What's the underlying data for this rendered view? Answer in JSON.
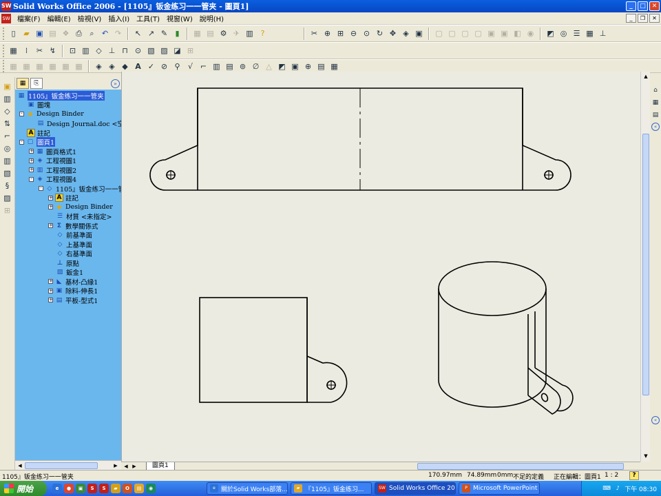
{
  "window": {
    "title": "Solid Works Office 2006 - [1105』钣金练习一一管夹 - 圖頁1]",
    "app_icon_text": "SW",
    "minimize": "_",
    "maximize": "□",
    "close": "✕"
  },
  "menu": {
    "items": [
      "檔案(F)",
      "編輯(E)",
      "檢視(V)",
      "插入(I)",
      "工具(T)",
      "視窗(W)",
      "說明(H)"
    ],
    "doc_minimize": "_",
    "doc_restore": "❐",
    "doc_close": "✕"
  },
  "feature_manager": {
    "tab1": "▦",
    "tab2": "⎘",
    "collapse": "»",
    "tree": [
      {
        "label": "1105』钣金练习一一管夹",
        "icon": "drawing-icon",
        "glyph": "▦",
        "indent": 0,
        "exp": "",
        "selected": true
      },
      {
        "label": "圖塊",
        "icon": "blocks-icon",
        "glyph": "▣",
        "indent": 1,
        "exp": ""
      },
      {
        "label": "Design Binder",
        "icon": "design-binder-icon",
        "glyph": "◆",
        "indent": 1,
        "exp": "-"
      },
      {
        "label": "Design Journal.doc <空白>",
        "icon": "document-icon",
        "glyph": "▤",
        "indent": 2,
        "exp": ""
      },
      {
        "label": "註記",
        "icon": "annotations-icon",
        "glyph": "A",
        "indent": 1,
        "exp": ""
      },
      {
        "label": "圖頁1",
        "icon": "sheet-icon",
        "glyph": "▢",
        "indent": 1,
        "exp": "-",
        "selected": true
      },
      {
        "label": "圖頁格式1",
        "icon": "sheet-format-icon",
        "glyph": "▦",
        "indent": 2,
        "exp": "+"
      },
      {
        "label": "工程視圖1",
        "icon": "drawing-view-icon",
        "glyph": "◈",
        "indent": 2,
        "exp": "+"
      },
      {
        "label": "工程視圖2",
        "icon": "drawing-view-icon",
        "glyph": "▥",
        "indent": 2,
        "exp": "+"
      },
      {
        "label": "工程視圖4",
        "icon": "drawing-view-icon",
        "glyph": "◈",
        "indent": 2,
        "exp": "-"
      },
      {
        "label": "1105』钣金练习一一管",
        "icon": "part-icon",
        "glyph": "◇",
        "indent": 3,
        "exp": "-"
      },
      {
        "label": "註記",
        "icon": "annotations-icon",
        "glyph": "A",
        "indent": 4,
        "exp": "+"
      },
      {
        "label": "Design Binder",
        "icon": "design-binder-icon",
        "glyph": "◆",
        "indent": 4,
        "exp": "+"
      },
      {
        "label": "材質 <未指定>",
        "icon": "material-icon",
        "glyph": "☰",
        "indent": 4,
        "exp": ""
      },
      {
        "label": "數學關係式",
        "icon": "equations-icon",
        "glyph": "Σ",
        "indent": 4,
        "exp": "+"
      },
      {
        "label": "前基準面",
        "icon": "plane-icon",
        "glyph": "◇",
        "indent": 4,
        "exp": ""
      },
      {
        "label": "上基準面",
        "icon": "plane-icon",
        "glyph": "◇",
        "indent": 4,
        "exp": ""
      },
      {
        "label": "右基準面",
        "icon": "plane-icon",
        "glyph": "◇",
        "indent": 4,
        "exp": ""
      },
      {
        "label": "原點",
        "icon": "origin-icon",
        "glyph": "⊥",
        "indent": 4,
        "exp": ""
      },
      {
        "label": "鈑金1",
        "icon": "sheet-metal-icon",
        "glyph": "▧",
        "indent": 4,
        "exp": ""
      },
      {
        "label": "基材-凸緣1",
        "icon": "base-flange-icon",
        "glyph": "◣",
        "indent": 4,
        "exp": "+"
      },
      {
        "label": "除料-伸長1",
        "icon": "cut-extrude-icon",
        "glyph": "▣",
        "indent": 4,
        "exp": "+"
      },
      {
        "label": "平板-型式1",
        "icon": "flat-pattern-icon",
        "glyph": "▤",
        "indent": 4,
        "exp": "+"
      }
    ]
  },
  "sheet_tab": "圖頁1",
  "status": {
    "left": "1105』钣金练习一一管夹",
    "x": "170.97mm",
    "y": "74.89mm",
    "z": "0mm",
    "state": "不足的定義",
    "editing": "正在編輯：圖頁1",
    "scale": "1 : 2",
    "help": "?"
  },
  "taskbar": {
    "start": "開始",
    "tasks": [
      {
        "label": "關於Solid Works部落...",
        "icon": "ie-icon",
        "color": "#2a72d8"
      },
      {
        "label": "『1105』钣金练习...",
        "icon": "folder-icon",
        "color": "#e0a82a"
      },
      {
        "label": "Solid Works Office 20...",
        "icon": "solidworks-icon",
        "color": "#c4201a",
        "active": true
      },
      {
        "label": "Microsoft PowerPoint ...",
        "icon": "powerpoint-icon",
        "color": "#d0521c"
      }
    ],
    "clock": "下午 08:30"
  },
  "colors": {
    "tree_bg": "#6ab7ee",
    "selection": "#2b5bd6",
    "sheet_bg": "#ecebe1"
  }
}
